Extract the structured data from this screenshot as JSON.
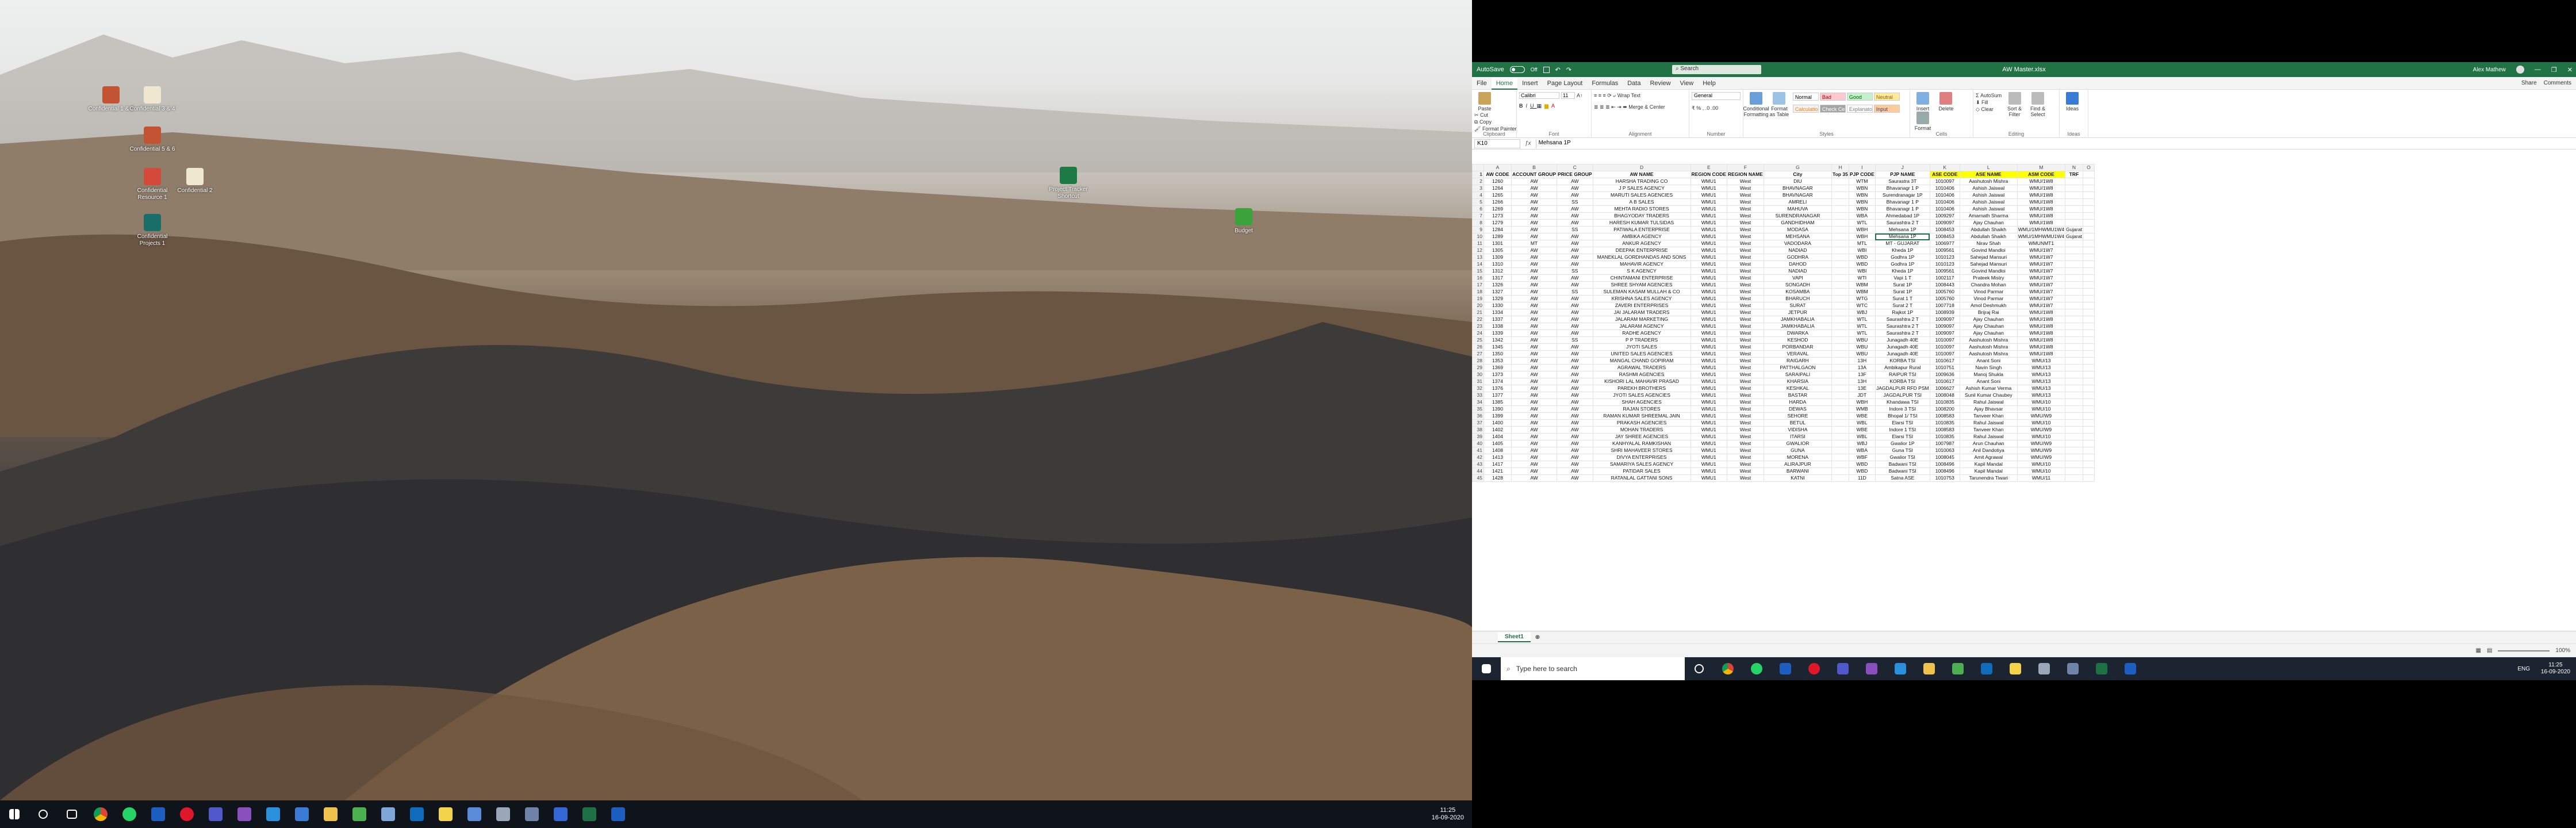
{
  "desktop": {
    "icons": [
      {
        "label": "Confidential 1 & 2",
        "color": "#c25433"
      },
      {
        "label": "Confidential 3 & 4",
        "color": "#efe7d0"
      },
      {
        "label": "Confidential 5 & 6",
        "color": "#c25433"
      },
      {
        "label": "Confidential Resource 1",
        "color": "#d44a3a"
      },
      {
        "label": "Confidential 2",
        "color": "#efe7d0"
      },
      {
        "label": "Confidential Projects 1",
        "color": "#1a6e6a"
      },
      {
        "label": "Project Tracker Shortcut",
        "color": "#1e7a45"
      },
      {
        "label": "Budget",
        "color": "#3ba33b"
      }
    ],
    "taskbar": {
      "time": "11:25",
      "date": "16-09-2020"
    }
  },
  "excel": {
    "title": "AW Master.xlsx",
    "autosave": "AutoSave",
    "autosave_state": "Off",
    "search_placeholder": "Search",
    "user": "Alex Mathew",
    "tabs": [
      "File",
      "Home",
      "Insert",
      "Page Layout",
      "Formulas",
      "Data",
      "Review",
      "View",
      "Help"
    ],
    "tab_right": [
      "Share",
      "Comments"
    ],
    "ribbon": {
      "clipboard": {
        "paste": "Paste",
        "cut": "Cut",
        "copy": "Copy",
        "painter": "Format Painter",
        "label": "Clipboard"
      },
      "font": {
        "name": "Calibri",
        "size": "11",
        "label": "Font"
      },
      "alignment": {
        "wrap": "Wrap Text",
        "merge": "Merge & Center",
        "label": "Alignment"
      },
      "number": {
        "format": "General",
        "label": "Number"
      },
      "styles": {
        "cond": "Conditional Formatting",
        "table": "Format as Table",
        "cells": [
          {
            "name": "Normal",
            "bg": "#ffffff",
            "fg": "#000000"
          },
          {
            "name": "Bad",
            "bg": "#ffc7ce",
            "fg": "#9c0006"
          },
          {
            "name": "Good",
            "bg": "#c6efce",
            "fg": "#006100"
          },
          {
            "name": "Neutral",
            "bg": "#ffeb9c",
            "fg": "#9c5700"
          },
          {
            "name": "Calculation",
            "bg": "#f2f2f2",
            "fg": "#fa7d00"
          },
          {
            "name": "Check Cell",
            "bg": "#a5a5a5",
            "fg": "#ffffff"
          },
          {
            "name": "Explanatory ...",
            "bg": "#ffffff",
            "fg": "#7f7f7f"
          },
          {
            "name": "Input",
            "bg": "#ffcc99",
            "fg": "#3f3f76"
          }
        ],
        "label": "Styles"
      },
      "cells": {
        "insert": "Insert",
        "delete": "Delete",
        "format": "Format",
        "label": "Cells"
      },
      "editing": {
        "autosum": "AutoSum",
        "fill": "Fill",
        "clear": "Clear",
        "sort": "Sort & Filter",
        "find": "Find & Select",
        "label": "Editing"
      },
      "ideas": {
        "label": "Ideas"
      }
    },
    "namebox": "K10",
    "formula": "Mehsana 1P",
    "columns": [
      "A",
      "B",
      "C",
      "D",
      "E",
      "F",
      "G",
      "H",
      "I",
      "J",
      "K",
      "L",
      "M",
      "N",
      "O"
    ],
    "header_row": [
      "AW CODE",
      "ACCOUNT GROUP",
      "PRICE GROUP",
      "AW NAME",
      "REGION CODE",
      "REGION NAME",
      "City",
      "Top 35",
      "PJP CODE",
      "PJP NAME",
      "ASE CODE",
      "ASE NAME",
      "ASM CODE",
      "TRF",
      ""
    ],
    "rows": [
      [
        "1260",
        "AW",
        "AW",
        "HARSHA TRADING CO",
        "WMU1",
        "West",
        "DIU",
        "",
        "WTM",
        "Saurastra 3T",
        "1010097",
        "Aashutosh Mishra",
        "WMU/1W8",
        ""
      ],
      [
        "1264",
        "AW",
        "AW",
        "J P SALES AGENCY",
        "WMU1",
        "West",
        "BHAVNAGAR",
        "",
        "WBN",
        "Bhavanagr 1 P",
        "1010406",
        "Ashish Jaiswal",
        "WMU/1W8",
        ""
      ],
      [
        "1265",
        "AW",
        "AW",
        "MARUTI SALES AGENCIES",
        "WMU1",
        "West",
        "BHAVNAGAR",
        "",
        "WBN",
        "Surendranagar 1P",
        "1010406",
        "Ashish Jaiswal",
        "WMU/1W8",
        ""
      ],
      [
        "1266",
        "AW",
        "SS",
        "A B SALES",
        "WMU1",
        "West",
        "AMRELI",
        "",
        "WBN",
        "Bhavanagr 1 P",
        "1010406",
        "Ashish Jaiswal",
        "WMU/1W8",
        ""
      ],
      [
        "1269",
        "AW",
        "AW",
        "MEHTA RADIO STORES",
        "WMU1",
        "West",
        "MAHUVA",
        "",
        "WBN",
        "Bhavanagr 1 P",
        "1010406",
        "Ashish Jaiswal",
        "WMU/1W8",
        ""
      ],
      [
        "1273",
        "AW",
        "AW",
        "BHAGYODAY TRADERS",
        "WMU1",
        "West",
        "SURENDRANAGAR",
        "",
        "WBA",
        "Ahmedabad 1P",
        "1009297",
        "Amarnath Sharma",
        "WMU/1W8",
        ""
      ],
      [
        "1279",
        "AW",
        "AW",
        "HARESH KUMAR TULSIDAS",
        "WMU1",
        "West",
        "GANDHIDHAM",
        "",
        "WTL",
        "Saurashtra 2 T",
        "1009097",
        "Ajay Chauhan",
        "WMU/1W8",
        ""
      ],
      [
        "1284",
        "AW",
        "SS",
        "PATIWALA ENTERPRISE",
        "WMU1",
        "West",
        "MODASA",
        "",
        "WBH",
        "Mehsana 1P",
        "1008453",
        "Abdullah Shaikh",
        "WMU/1MHWMU1W4",
        "Gujarat"
      ],
      [
        "1289",
        "AW",
        "AW",
        "AMBIKA AGENCY",
        "WMU1",
        "West",
        "MEHSANA",
        "",
        "WBH",
        "Mehsana 1P",
        "1008453",
        "Abdullah Shaikh",
        "WMU/1MHWMU1W4",
        "Gujarat"
      ],
      [
        "1301",
        "MT",
        "AW",
        "ANKUR AGENCY",
        "WMU1",
        "West",
        "VADODARA",
        "",
        "MTL",
        "MT - GUJARAT",
        "1006977",
        "Nirav Shah",
        "WMUNMT1",
        ""
      ],
      [
        "1305",
        "AW",
        "AW",
        "DEEPAK ENTERPRISE",
        "WMU1",
        "West",
        "NADIAD",
        "",
        "WBI",
        "Kheda 1P",
        "1009561",
        "Govind Mandloi",
        "WMU/1W7",
        ""
      ],
      [
        "1309",
        "AW",
        "AW",
        "MANEKLAL GORDHANDAS AND SONS",
        "WMU1",
        "West",
        "GODHRA",
        "",
        "WBD",
        "Godhra 1P",
        "1010123",
        "Sahejad Mansuri",
        "WMU/1W7",
        ""
      ],
      [
        "1310",
        "AW",
        "AW",
        "MAHAVIR AGENCY",
        "WMU1",
        "West",
        "DAHOD",
        "",
        "WBD",
        "Godhra 1P",
        "1010123",
        "Sahejad Mansuri",
        "WMU/1W7",
        ""
      ],
      [
        "1312",
        "AW",
        "SS",
        "S K AGENCY",
        "WMU1",
        "West",
        "NADIAD",
        "",
        "WBI",
        "Kheda 1P",
        "1009561",
        "Govind Mandloi",
        "WMU/1W7",
        ""
      ],
      [
        "1317",
        "AW",
        "AW",
        "CHINTAMANI ENTERPRISE",
        "WMU1",
        "West",
        "VAPI",
        "",
        "WTI",
        "Vapi 1 T",
        "1002117",
        "Prateek Mistry",
        "WMU/1W7",
        ""
      ],
      [
        "1326",
        "AW",
        "AW",
        "SHREE SHYAM AGENCIES",
        "WMU1",
        "West",
        "SONGADH",
        "",
        "WBM",
        "Surat 1P",
        "1008443",
        "Chandra Mohan",
        "WMU/1W7",
        ""
      ],
      [
        "1327",
        "AW",
        "SS",
        "SULEMAN KASAM MULLAH & CO",
        "WMU1",
        "West",
        "KOSAMBA",
        "",
        "WBM",
        "Surat 1P",
        "1005760",
        "Vinod Parmar",
        "WMU/1W7",
        ""
      ],
      [
        "1329",
        "AW",
        "AW",
        "KRISHNA SALES AGENCY",
        "WMU1",
        "West",
        "BHARUCH",
        "",
        "WTG",
        "Surat 1 T",
        "1005760",
        "Vinod Parmar",
        "WMU/1W7",
        ""
      ],
      [
        "1330",
        "AW",
        "AW",
        "ZAVERI ENTERPRISES",
        "WMU1",
        "West",
        "SURAT",
        "",
        "WTC",
        "Surat 2 T",
        "1007718",
        "Amol Deshmukh",
        "WMU/1W7",
        ""
      ],
      [
        "1334",
        "AW",
        "AW",
        "JAI JALARAM TRADERS",
        "WMU1",
        "West",
        "JETPUR",
        "",
        "WBJ",
        "Rajkot 1P",
        "1008939",
        "Brijraj Rai",
        "WMU/1W8",
        ""
      ],
      [
        "1337",
        "AW",
        "AW",
        "JALARAM MARKETING",
        "WMU1",
        "West",
        "JAMKHABALIA",
        "",
        "WTL",
        "Saurashtra 2 T",
        "1009097",
        "Ajay Chauhan",
        "WMU/1W8",
        ""
      ],
      [
        "1338",
        "AW",
        "AW",
        "JALARAM AGENCY",
        "WMU1",
        "West",
        "JAMKHABALIA",
        "",
        "WTL",
        "Saurashtra 2 T",
        "1009097",
        "Ajay Chauhan",
        "WMU/1W8",
        ""
      ],
      [
        "1339",
        "AW",
        "AW",
        "RADHE AGENCY",
        "WMU1",
        "West",
        "DWARKA",
        "",
        "WTL",
        "Saurashtra 2 T",
        "1009097",
        "Ajay Chauhan",
        "WMU/1W8",
        ""
      ],
      [
        "1342",
        "AW",
        "SS",
        "P P TRADERS",
        "WMU1",
        "West",
        "KESHOD",
        "",
        "WBU",
        "Junagadh 40E",
        "1010097",
        "Aashutosh Mishra",
        "WMU/1W8",
        ""
      ],
      [
        "1345",
        "AW",
        "AW",
        "JYOTI SALES",
        "WMU1",
        "West",
        "PORBANDAR",
        "",
        "WBU",
        "Junagadh 40E",
        "1010097",
        "Aashutosh Mishra",
        "WMU/1W8",
        ""
      ],
      [
        "1350",
        "AW",
        "AW",
        "UNITED SALES AGENCIES",
        "WMU1",
        "West",
        "VERAVAL",
        "",
        "WBU",
        "Junagadh 40E",
        "1010097",
        "Aashutosh Mishra",
        "WMU/1W8",
        ""
      ],
      [
        "1353",
        "AW",
        "AW",
        "MANGAL CHAND GOPIRAM",
        "WMU1",
        "West",
        "RAIGARH",
        "",
        "13H",
        "KORBA TSI",
        "1010617",
        "Anant Soni",
        "WMU/13",
        ""
      ],
      [
        "1369",
        "AW",
        "AW",
        "AGRAWAL TRADERS",
        "WMU1",
        "West",
        "PATTHALGAON",
        "",
        "13A",
        "Ambikapur Rural",
        "1010751",
        "Navin Singh",
        "WMU/13",
        ""
      ],
      [
        "1373",
        "AW",
        "AW",
        "RASHMI AGENCIES",
        "WMU1",
        "West",
        "SARAIPALI",
        "",
        "13F",
        "RAIPUR TSI",
        "1009636",
        "Manoj Shukla",
        "WMU/13",
        ""
      ],
      [
        "1374",
        "AW",
        "AW",
        "KISHORI LAL MAHAVIR PRASAD",
        "WMU1",
        "West",
        "KHARSIA",
        "",
        "13H",
        "KORBA TSI",
        "1010617",
        "Anant Soni",
        "WMU/13",
        ""
      ],
      [
        "1376",
        "AW",
        "AW",
        "PAREKH BROTHERS",
        "WMU1",
        "West",
        "KESHKAL",
        "",
        "13E",
        "JAGDALPUR RFD PSM",
        "1006627",
        "Ashish Kumar Verma",
        "WMU/13",
        ""
      ],
      [
        "1377",
        "AW",
        "AW",
        "JYOTI SALES AGENCIES",
        "WMU1",
        "West",
        "BASTAR",
        "",
        "JDT",
        "JAGDALPUR TSI",
        "1008048",
        "Sunil Kumar Chaubey",
        "WMU/13",
        ""
      ],
      [
        "1385",
        "AW",
        "AW",
        "SHAH AGENCIES",
        "WMU1",
        "West",
        "HARDA",
        "",
        "WBH",
        "Khandawa TSI",
        "1010835",
        "Rahul Jaiswal",
        "WMU/10",
        ""
      ],
      [
        "1390",
        "AW",
        "AW",
        "RAJAN STORES",
        "WMU1",
        "West",
        "DEWAS",
        "",
        "WMB",
        "Indore 3 TSI",
        "1008200",
        "Ajay Bhavsar",
        "WMU/10",
        ""
      ],
      [
        "1399",
        "AW",
        "AW",
        "RAMAN KUMAR SHREEMAL JAIN",
        "WMU1",
        "West",
        "SEHORE",
        "",
        "WBE",
        "Bhopal 1/ TSI",
        "1008583",
        "Tanveer Khan",
        "WMU/W9",
        ""
      ],
      [
        "1400",
        "AW",
        "AW",
        "PRAKASH AGENCIES",
        "WMU1",
        "West",
        "BETUL",
        "",
        "WBL",
        "Elarsi TSI",
        "1010835",
        "Rahul Jaiswal",
        "WMU/10",
        ""
      ],
      [
        "1402",
        "AW",
        "AW",
        "MOHAN TRADERS",
        "WMU1",
        "West",
        "VIDISHA",
        "",
        "WBE",
        "Indore 1 TSI",
        "1008583",
        "Tanveer Khan",
        "WMU/W9",
        ""
      ],
      [
        "1404",
        "AW",
        "AW",
        "JAY SHREE AGENCIES",
        "WMU1",
        "West",
        "ITARSI",
        "",
        "WBL",
        "Elarsi TSI",
        "1010835",
        "Rahul Jaiswal",
        "WMU/10",
        ""
      ],
      [
        "1405",
        "AW",
        "AW",
        "KANHYALAL RAMKISHAN",
        "WMU1",
        "West",
        "GWALIOR",
        "",
        "WBJ",
        "Gwalior 1P",
        "1007987",
        "Arun Chauhan",
        "WMU/W9",
        ""
      ],
      [
        "1408",
        "AW",
        "AW",
        "SHRI MAHAVEER STORES",
        "WMU1",
        "West",
        "GUNA",
        "",
        "WBA",
        "Guna TSI",
        "1010063",
        "Anil Dandotiya",
        "WMU/W9",
        ""
      ],
      [
        "1413",
        "AW",
        "AW",
        "DIVYA ENTERPRISES",
        "WMU1",
        "West",
        "MORENA",
        "",
        "WBF",
        "Gwalior TSI",
        "1008045",
        "Amit Agrawal",
        "WMU/W9",
        ""
      ],
      [
        "1417",
        "AW",
        "AW",
        "SAMARIYA SALES AGENCY",
        "WMU1",
        "West",
        "ALIRAJPUR",
        "",
        "WBD",
        "Badwani TSI",
        "1008496",
        "Kapil Mandal",
        "WMU/10",
        ""
      ],
      [
        "1421",
        "AW",
        "AW",
        "PATIDAR SALES",
        "WMU1",
        "West",
        "BARWANI",
        "",
        "WBD",
        "Badwani TSI",
        "1008496",
        "Kapil Mandal",
        "WMU/10",
        ""
      ],
      [
        "1428",
        "AW",
        "AW",
        "RATANLAL GATTANI SONS",
        "WMU1",
        "West",
        "KATNI",
        "",
        "11D",
        "Satna ASE",
        "1010753",
        "Tarunendra Tiwari",
        "WMU/11",
        ""
      ]
    ],
    "sheet": "Sheet1",
    "zoom": "100%"
  },
  "right_taskbar": {
    "search": "Type here to search",
    "lang": "ENG",
    "time": "11:25",
    "date": "16-09-2020"
  }
}
